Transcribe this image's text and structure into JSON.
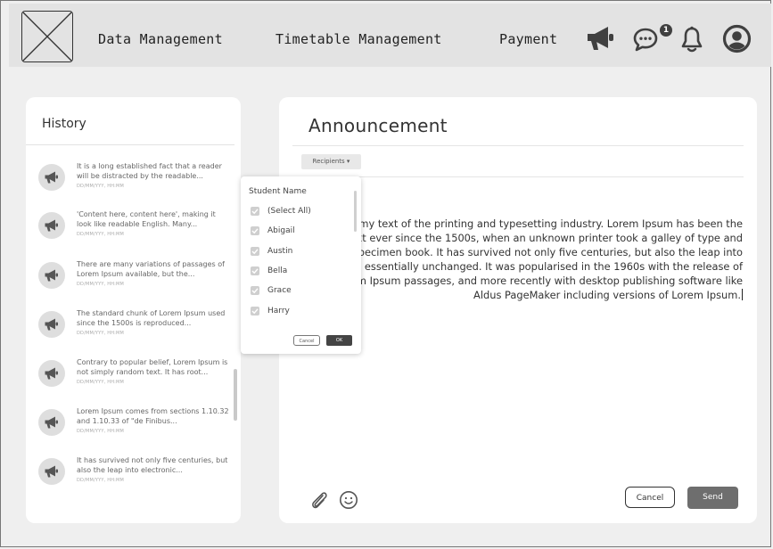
{
  "nav": {
    "data_management": "Data Management",
    "timetable_management": "Timetable Management",
    "payment": "Payment",
    "chat_badge": "1"
  },
  "history": {
    "title": "History",
    "items": [
      {
        "text": "It is a long established fact that a reader will be distracted by the readable...",
        "date": "DD/MM/YYY, HH:MM"
      },
      {
        "text": "'Content here, content here', making it look like readable English. Many...",
        "date": "DD/MM/YYY, HH:MM"
      },
      {
        "text": "There are many variations of passages of Lorem Ipsum available, but the...",
        "date": "DD/MM/YYY, HH:MM"
      },
      {
        "text": "The standard chunk of Lorem Ipsum used since the 1500s is reproduced...",
        "date": "DD/MM/YYY, HH:MM"
      },
      {
        "text": "Contrary to popular belief, Lorem Ipsum is not simply random text. It has root...",
        "date": "DD/MM/YYY, HH:MM"
      },
      {
        "text": "Lorem Ipsum comes from sections 1.10.32 and 1.10.33 of \"de Finibus...",
        "date": "DD/MM/YYY, HH:MM"
      },
      {
        "text": "It has survived not only five centuries, but also the leap into electronic...",
        "date": "DD/MM/YYY, HH:MM"
      }
    ]
  },
  "announcement": {
    "title": "Announcement",
    "recipients_label": "Recipients ▾",
    "body": "Lorem Ipsum is simply dummy text of the printing and typesetting industry. Lorem Ipsum has been the industry's standard dummy text ever since the 1500s, when an unknown printer took a galley of type and scrambled it to make a type specimen book. It has survived not only five centuries, but also the leap into electronic typesetting, remaining essentially unchanged. It was popularised in the 1960s with the release of Letraset sheets containing Lorem Ipsum passages, and more recently with desktop publishing software like Aldus PageMaker including versions of Lorem Ipsum.",
    "cancel_label": "Cancel",
    "send_label": "Send"
  },
  "dropdown": {
    "title": "Student Name",
    "options": [
      {
        "label": "(Select All)",
        "checked": true
      },
      {
        "label": "Abigail",
        "checked": true
      },
      {
        "label": "Austin",
        "checked": true
      },
      {
        "label": "Bella",
        "checked": true
      },
      {
        "label": "Grace",
        "checked": true
      },
      {
        "label": "Harry",
        "checked": true
      }
    ],
    "cancel_label": "Cancel",
    "ok_label": "OK"
  },
  "icons": {
    "megaphone": "megaphone-icon",
    "chat": "chat-icon",
    "bell": "bell-icon",
    "profile": "user-circle-icon",
    "attach": "paperclip-icon",
    "emoji": "smiley-icon"
  },
  "colors": {
    "topbar": "#e3e3e3",
    "background": "#efefef",
    "icon": "#404040",
    "send_button": "#6e6e6e"
  }
}
